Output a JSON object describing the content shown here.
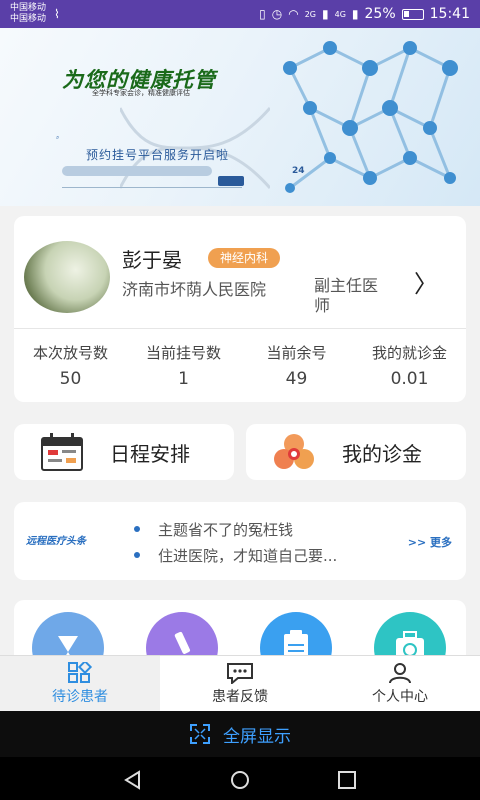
{
  "status_bar": {
    "carrier1": "中国移动",
    "carrier2": "中国移动",
    "net1": "2G",
    "net2": "4G",
    "battery": "25%",
    "time": "15:41"
  },
  "banner": {
    "title": "为您的健康托管",
    "subtitle": "全学科专家会诊，精准健康评估",
    "notice": "预约挂号平台服务开启啦",
    "hotline": "24"
  },
  "doctor": {
    "name": "彭于晏",
    "department": "神经内科",
    "hospital": "济南市坏荫人民医院",
    "title": "副主任医师"
  },
  "stats": [
    {
      "label": "本次放号数",
      "value": "50"
    },
    {
      "label": "当前挂号数",
      "value": "1"
    },
    {
      "label": "当前余号",
      "value": "49"
    },
    {
      "label": "我的就诊金",
      "value": "0.01"
    }
  ],
  "actions": {
    "schedule": "日程安排",
    "fund": "我的诊金"
  },
  "news": {
    "logo": "远程医疗头条",
    "items": [
      "主题省不了的冤枉钱",
      "住进医院，才知道自己要..."
    ],
    "more": ">> 更多"
  },
  "tabs": [
    {
      "label": "待诊患者"
    },
    {
      "label": "患者反馈"
    },
    {
      "label": "个人中心"
    }
  ],
  "fullscreen_label": "全屏显示",
  "colors": {
    "accent": "#2f8ee0",
    "badge": "#f0a050",
    "status_bar": "#5a3fa8"
  }
}
